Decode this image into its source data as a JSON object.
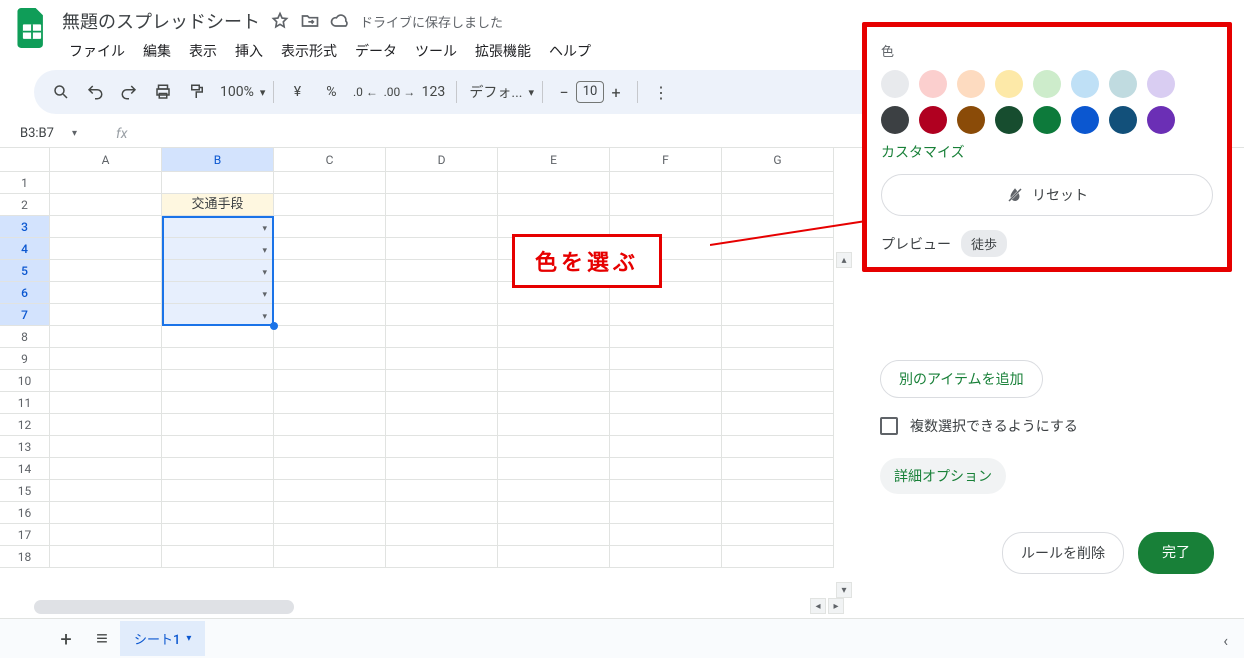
{
  "header": {
    "doc_title": "無題のスプレッドシート",
    "save_status": "ドライブに保存しました",
    "menus": [
      "ファイル",
      "編集",
      "表示",
      "挿入",
      "表示形式",
      "データ",
      "ツール",
      "拡張機能",
      "ヘルプ"
    ]
  },
  "toolbar": {
    "zoom": "100%",
    "font": "デフォ...",
    "font_size": "10"
  },
  "namebox": "B3:B7",
  "grid": {
    "cols": [
      "A",
      "B",
      "C",
      "D",
      "E",
      "F",
      "G"
    ],
    "selected_col": "B",
    "row_count": 18,
    "selected_rows": [
      3,
      4,
      5,
      6,
      7
    ],
    "b2_header": "交通手段"
  },
  "panel": {
    "title": "色",
    "light_colors": [
      "#e8eaed",
      "#fbcfce",
      "#fddbc0",
      "#fde9a8",
      "#cdeccb",
      "#bfe0f6",
      "#c0dbe0",
      "#d9cdf2"
    ],
    "dark_colors": [
      "#3c4043",
      "#b00020",
      "#8a4b08",
      "#174d2f",
      "#0d7a3b",
      "#0b57d0",
      "#12507a",
      "#6b2fb5"
    ],
    "customize": "カスタマイズ",
    "reset": "リセット",
    "preview_label": "プレビュー",
    "preview_chip": "徒歩"
  },
  "dv": {
    "add_item": "別のアイテムを追加",
    "multi_select": "複数選択できるようにする",
    "advanced": "詳細オプション",
    "delete_rule": "ルールを削除",
    "done": "完了"
  },
  "callout": "色を選ぶ",
  "tabs": {
    "sheet1": "シート1"
  }
}
